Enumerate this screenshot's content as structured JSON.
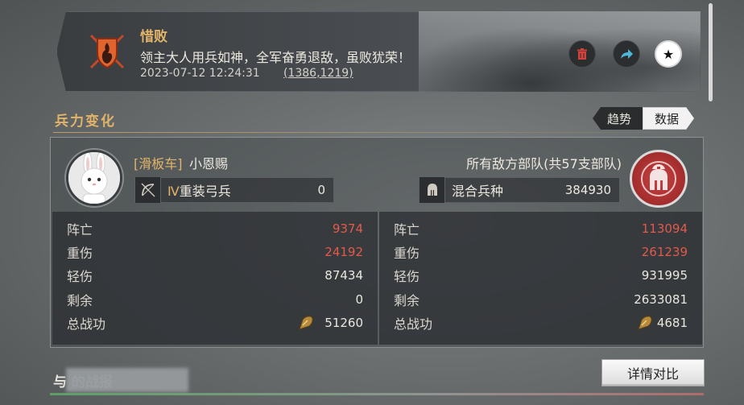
{
  "report": {
    "result": "惜败",
    "message": "领主大人用兵如神，全军奋勇退敌，虽败犹荣！",
    "timestamp": "2023-07-12 12:24:31",
    "coords": "(1386,1219)"
  },
  "actions": {
    "delete_icon": "trash-icon",
    "share_icon": "share-arrow-icon",
    "favorite_icon": "star-icon"
  },
  "section": {
    "title": "兵力变化",
    "tabs": [
      {
        "label": "趋势",
        "active": false
      },
      {
        "label": "数据",
        "active": true
      }
    ]
  },
  "left": {
    "alliance": "[滑板车]",
    "player": "小恩赐",
    "unit_tier": "Ⅳ",
    "unit_name": "重装弓兵",
    "unit_count": "0",
    "stats": [
      {
        "label": "阵亡",
        "value": "9374",
        "highlight": true
      },
      {
        "label": "重伤",
        "value": "24192",
        "highlight": true
      },
      {
        "label": "轻伤",
        "value": "87434",
        "highlight": false
      },
      {
        "label": "剩余",
        "value": "0",
        "highlight": false
      },
      {
        "label": "总战功",
        "value": "51260",
        "highlight": false
      }
    ]
  },
  "right": {
    "title": "所有敌方部队(共57支部队)",
    "unit_name": "混合兵种",
    "unit_count": "384930",
    "stats": [
      {
        "label": "阵亡",
        "value": "113094",
        "highlight": true
      },
      {
        "label": "重伤",
        "value": "261239",
        "highlight": true
      },
      {
        "label": "轻伤",
        "value": "931995",
        "highlight": false
      },
      {
        "label": "剩余",
        "value": "2633081",
        "highlight": false
      },
      {
        "label": "总战功",
        "value": "4681",
        "highlight": false
      }
    ]
  },
  "footer": {
    "title": "与 的战报",
    "detail_button": "详情对比"
  },
  "colors": {
    "gold": "#e2b46a",
    "red_value": "#e25a4a",
    "enemy_badge": "#a22c2c"
  }
}
